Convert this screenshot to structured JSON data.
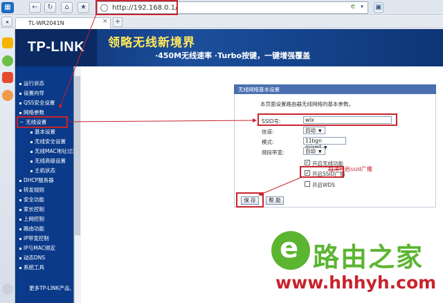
{
  "browser": {
    "url": "http://192.168.0.1/",
    "tab_title": "TL-WR2041N"
  },
  "banner": {
    "logo": "TP-LINK",
    "slogan_main": "领略无线新境界",
    "slogan_sub": "·450M无线速率 ·Turbo按键，一键增强覆盖"
  },
  "sidebar": {
    "items": [
      {
        "label": "运行状态"
      },
      {
        "label": "设置向导"
      },
      {
        "label": "QSS安全设置"
      },
      {
        "label": "网络参数"
      },
      {
        "label": "无线设置"
      },
      {
        "label": "DHCP服务器"
      },
      {
        "label": "转发规则"
      },
      {
        "label": "安全功能"
      },
      {
        "label": "家长控制"
      },
      {
        "label": "上网控制"
      },
      {
        "label": "路由功能"
      },
      {
        "label": "IP带宽控制"
      },
      {
        "label": "IP与MAC绑定"
      },
      {
        "label": "动态DNS"
      },
      {
        "label": "系统工具"
      }
    ],
    "wireless_sub": [
      {
        "label": "基本设置"
      },
      {
        "label": "无线安全设置"
      },
      {
        "label": "无线MAC地址过滤"
      },
      {
        "label": "无线高级设置"
      },
      {
        "label": "主机状态"
      }
    ],
    "more": "更多TP-LINK产品,"
  },
  "panel": {
    "title": "无线网络基本设置",
    "description": "本页面设置路由器无线网络的基本参数。",
    "ssid_label": "SSID号:",
    "ssid_value": "wlx",
    "channel_label": "信道:",
    "channel_value": "自动",
    "mode_label": "模式:",
    "mode_value": "11bgn mixed",
    "bandwidth_label": "频段带宽:",
    "bandwidth_value": "自动",
    "enable_wireless": "开启无线功能",
    "enable_ssid_broadcast": "开启SSID广播",
    "enable_wds": "开启WDS",
    "save": "保 存",
    "help": "帮 助"
  },
  "annotation": "取消开启ssid广播",
  "watermark": {
    "name": "路由之家",
    "url": "www.hhhyh.com"
  }
}
